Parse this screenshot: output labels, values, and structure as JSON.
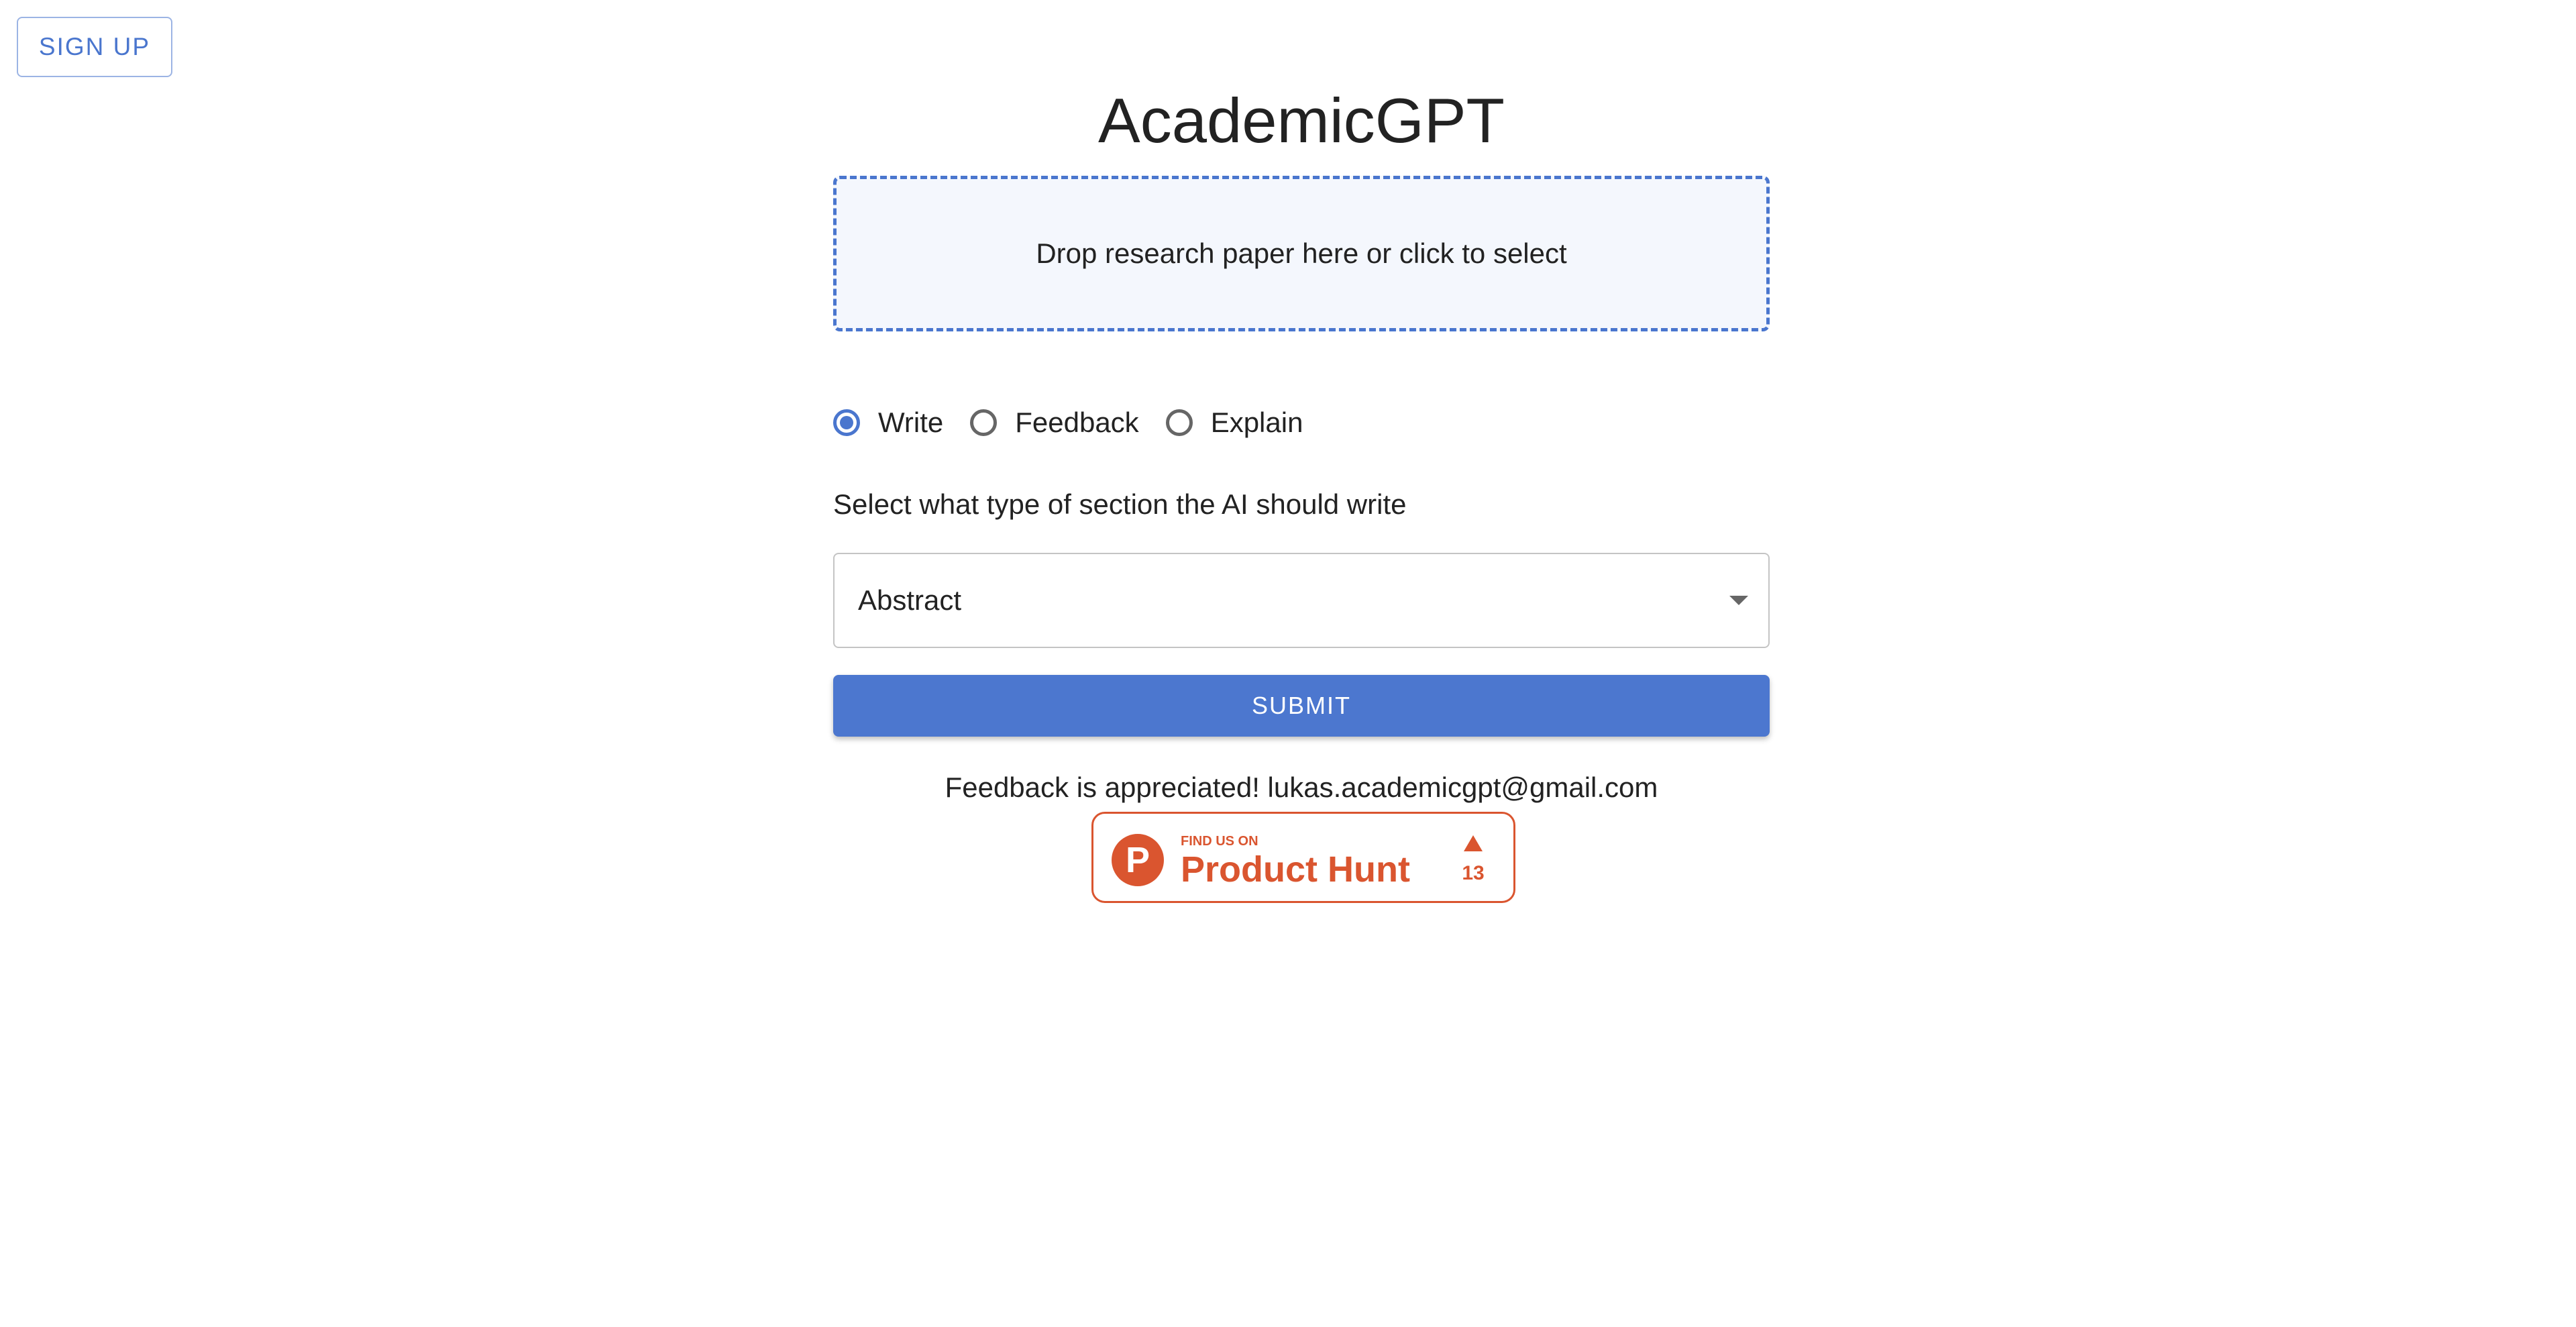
{
  "header": {
    "signup_label": "SIGN UP"
  },
  "app": {
    "title": "AcademicGPT"
  },
  "upload": {
    "dropzone_text": "Drop research paper here or click to select"
  },
  "modes": {
    "options": [
      {
        "label": "Write",
        "selected": true
      },
      {
        "label": "Feedback",
        "selected": false
      },
      {
        "label": "Explain",
        "selected": false
      }
    ]
  },
  "section": {
    "prompt": "Select what type of section the AI should write",
    "selected_value": "Abstract"
  },
  "submit": {
    "label": "SUBMIT"
  },
  "footer": {
    "feedback_text": "Feedback is appreciated! lukas.academicgpt@gmail.com"
  },
  "product_hunt": {
    "logo_letter": "P",
    "small_text": "FIND US ON",
    "big_text": "Product Hunt",
    "upvote_count": "13"
  },
  "colors": {
    "accent": "#4a76ce",
    "product_hunt": "#da552f",
    "dropzone_bg": "#f4f7fd"
  }
}
